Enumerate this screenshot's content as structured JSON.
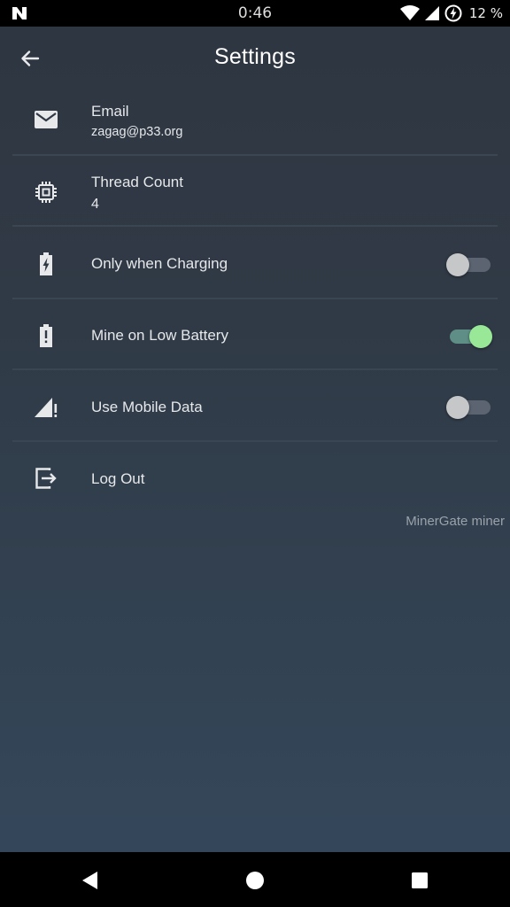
{
  "status_bar": {
    "time": "0:46",
    "battery_percent": "12 %"
  },
  "toolbar": {
    "title": "Settings"
  },
  "settings": {
    "email": {
      "label": "Email",
      "value": "zagag@p33.org",
      "icon": "mail-icon"
    },
    "thread_count": {
      "label": "Thread Count",
      "value": "4",
      "icon": "chip-icon"
    },
    "only_when_charging": {
      "label": "Only when Charging",
      "enabled": false,
      "icon": "battery-charging-icon"
    },
    "mine_on_low_battery": {
      "label": "Mine on Low Battery",
      "enabled": true,
      "icon": "battery-alert-icon"
    },
    "use_mobile_data": {
      "label": "Use Mobile Data",
      "enabled": false,
      "icon": "signal-alert-icon"
    },
    "log_out": {
      "label": "Log Out",
      "icon": "exit-icon"
    }
  },
  "footer": {
    "note": "MinerGate miner"
  },
  "colors": {
    "switch_on_thumb": "#98e898",
    "switch_on_track": "#5e8e86",
    "switch_off_thumb": "#c5c7c9",
    "background_top": "#2e3641",
    "background_bottom": "#34475a"
  }
}
